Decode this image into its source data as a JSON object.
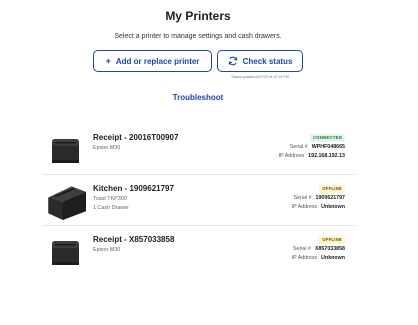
{
  "header": {
    "title": "My Printers",
    "subtitle": "Select a printer to manage settings and cash drawers."
  },
  "actions": {
    "add_label": "Add or replace printer",
    "check_label": "Check status",
    "status_updated": "Status updated 6/27/23 at 12:19 PM",
    "troubleshoot_label": "Troubleshoot"
  },
  "labels": {
    "serial": "Serial #",
    "ip": "IP Address"
  },
  "printers": [
    {
      "name": "Receipt - 20016T00907",
      "model": "Epson M30",
      "extra": "",
      "status": "CONNECTED",
      "serial": "WPHF048665",
      "ip": "192.168.192.13"
    },
    {
      "name": "Kitchen - 1909621797",
      "model": "Toast TKP300",
      "extra": "1 Cash Drawer",
      "status": "OFFLINE",
      "serial": "1909621797",
      "ip": "Unknown"
    },
    {
      "name": "Receipt - X857033858",
      "model": "Epson M30",
      "extra": "",
      "status": "OFFLINE",
      "serial": "X857033858",
      "ip": "Unknown"
    }
  ],
  "icons": {
    "add": "plus-icon",
    "check": "refresh-icon"
  },
  "colors": {
    "accent": "#1f46a6",
    "connected_bg": "#e3f6e9",
    "connected_fg": "#1b6b37",
    "offline_bg": "#fff5cc",
    "offline_fg": "#6a5600"
  }
}
